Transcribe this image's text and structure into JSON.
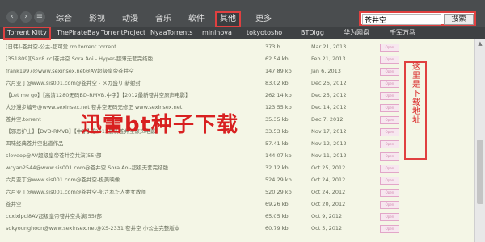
{
  "nav": {
    "back_icon": "‹",
    "forward_icon": "›",
    "menu_icon": "≡",
    "categories": [
      "综合",
      "影视",
      "动漫",
      "音乐",
      "软件",
      "其他",
      "更多"
    ],
    "active_category": "其他"
  },
  "search": {
    "value": "苍井空",
    "button_label": "搜索"
  },
  "tabs": {
    "items": [
      "Torrent Kitty",
      "ThePirateBay",
      "TorrentProject",
      "NyaaTorrents",
      "mininova",
      "tokyotosho",
      "BTDigg",
      "华为网盘",
      "千军万马"
    ],
    "active": "Torrent Kitty"
  },
  "rows": [
    {
      "title": "[日韩]-苍井空-公主-超可爱.rm.torrent.torrent",
      "size": "373 b",
      "date": "Mar 21, 2013",
      "download_label": "Open"
    },
    {
      "title": "[351809][Sex8.cc]苍井空 Sora Aoi - Hyper-超薄无套完结版",
      "size": "62.54 kb",
      "date": "Feb 21, 2013",
      "download_label": "Open"
    },
    {
      "title": "frank1997@www.sexinsex.net@AV超级皇帝苍井空",
      "size": "147.89 kb",
      "date": "Jan 6, 2013",
      "download_label": "Open"
    },
    {
      "title": "六月亚丁@www.sis001.com@苍井空 - メガ盛り 新射封",
      "size": "83.02 kb",
      "date": "Dec 26, 2012",
      "download_label": "Open"
    },
    {
      "title": "【Let me go】【高清1280无码BD-RMVB.中字】【2012最新苍井空原声电影】",
      "size": "262.14 kb",
      "date": "Dec 25, 2012",
      "download_label": "Open"
    },
    {
      "title": "大沙漫步编号@www.sexinsex.net 苍井空无码无修正 www.sexinsex.net",
      "size": "123.55 kb",
      "date": "Dec 14, 2012",
      "download_label": "Open"
    },
    {
      "title": "苍井空.torrent",
      "size": "35.35 kb",
      "date": "Dec 7, 2012",
      "download_label": "Open"
    },
    {
      "title": "【邪恶护士】【DVD-RMVB】【中字】【2012最新苍井空原声电影】",
      "size": "33.53 kb",
      "date": "Nov 17, 2012",
      "download_label": "Open"
    },
    {
      "title": "四味经典苍井空出道作品",
      "size": "57.41 kb",
      "date": "Nov 12, 2012",
      "download_label": "Open"
    },
    {
      "title": "sleveop@AV超级皇帝苍井空共演(55)部",
      "size": "144.07 kb",
      "date": "Nov 11, 2012",
      "download_label": "Open"
    },
    {
      "title": "wcyan2544@www.sis001.com@苍井空 Sora Aoi-超级无套完结版",
      "size": "32.12 kb",
      "date": "Oct 25, 2012",
      "download_label": "Open"
    },
    {
      "title": "六月亚丁@www.sis001.com@苍井空-极美映像",
      "size": "524.29 kb",
      "date": "Oct 24, 2012",
      "download_label": "Open"
    },
    {
      "title": "六月亚丁@www.sis001.com@苍井空-犯された人妻女教师",
      "size": "520.29 kb",
      "date": "Oct 24, 2012",
      "download_label": "Open"
    },
    {
      "title": "苍井空",
      "size": "69.26 kb",
      "date": "Oct 20, 2012",
      "download_label": "Open"
    },
    {
      "title": "ccxlxlpcl8AV超级皇帝苍井空共演(55)部",
      "size": "65.05 kb",
      "date": "Oct 9, 2012",
      "download_label": "Open"
    },
    {
      "title": "sokyounghoon@www.sexinsex.net@XS-2331 苍井空 小公主完整版本",
      "size": "60.79 kb",
      "date": "Oct 5, 2012",
      "download_label": "Open"
    }
  ],
  "annotation": {
    "overlay_text": "迅雷bt种子下载",
    "side_label": "这里是下载地址"
  },
  "colors": {
    "accent_red": "#e04040",
    "topbar_bg": "#4a4d4f",
    "list_bg": "#f4f6e6"
  }
}
